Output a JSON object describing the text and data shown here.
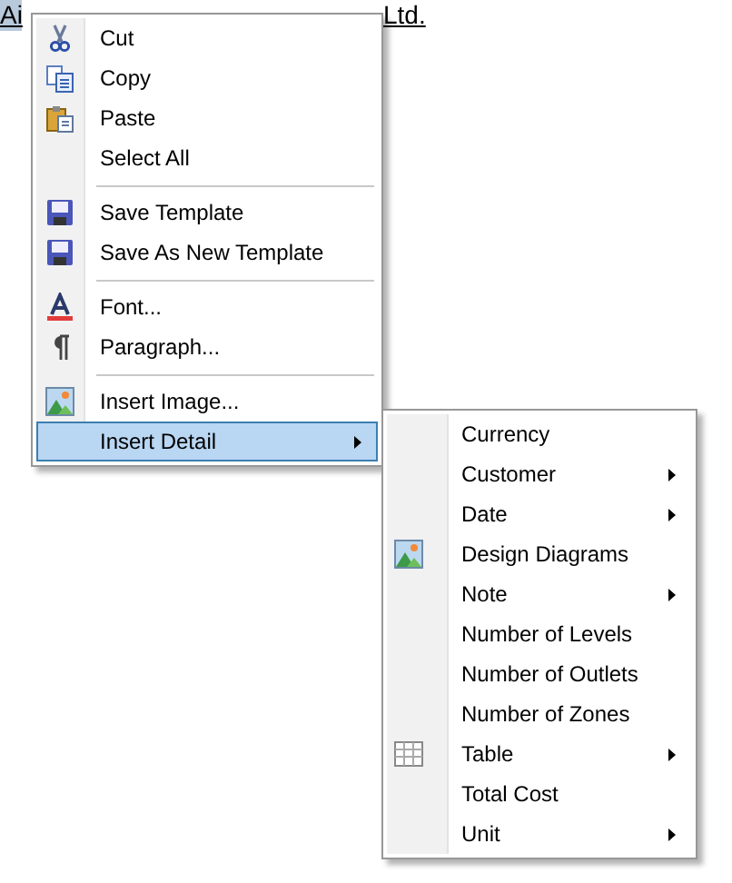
{
  "document": {
    "selected_text": "Ai",
    "visible_end": "Ltd."
  },
  "context_menu": [
    {
      "kind": "cut",
      "label": "Cut",
      "selected": false,
      "submenu": false
    },
    {
      "kind": "copy",
      "label": "Copy",
      "selected": false,
      "submenu": false
    },
    {
      "kind": "paste",
      "label": "Paste",
      "selected": false,
      "submenu": false
    },
    {
      "kind": "plain",
      "label": "Select All",
      "selected": false,
      "submenu": false
    },
    {
      "kind": "separator"
    },
    {
      "kind": "save",
      "label": "Save Template",
      "selected": false,
      "submenu": false
    },
    {
      "kind": "save",
      "label": "Save As New Template",
      "selected": false,
      "submenu": false
    },
    {
      "kind": "separator"
    },
    {
      "kind": "font",
      "label": "Font...",
      "selected": false,
      "submenu": false
    },
    {
      "kind": "paragraph",
      "label": "Paragraph...",
      "selected": false,
      "submenu": false
    },
    {
      "kind": "separator"
    },
    {
      "kind": "image",
      "label": "Insert Image...",
      "selected": false,
      "submenu": false
    },
    {
      "kind": "plain",
      "label": "Insert Detail",
      "selected": true,
      "submenu": true
    }
  ],
  "submenu": [
    {
      "kind": "plain",
      "label": "Currency",
      "selected": false,
      "submenu": false
    },
    {
      "kind": "plain",
      "label": "Customer",
      "selected": false,
      "submenu": true
    },
    {
      "kind": "plain",
      "label": "Date",
      "selected": false,
      "submenu": true
    },
    {
      "kind": "image",
      "label": "Design Diagrams",
      "selected": false,
      "submenu": false
    },
    {
      "kind": "plain",
      "label": "Note",
      "selected": false,
      "submenu": true
    },
    {
      "kind": "plain",
      "label": "Number of Levels",
      "selected": false,
      "submenu": false
    },
    {
      "kind": "plain",
      "label": "Number of Outlets",
      "selected": false,
      "submenu": false
    },
    {
      "kind": "plain",
      "label": "Number of Zones",
      "selected": false,
      "submenu": false
    },
    {
      "kind": "table",
      "label": "Table",
      "selected": false,
      "submenu": true
    },
    {
      "kind": "plain",
      "label": "Total Cost",
      "selected": false,
      "submenu": false
    },
    {
      "kind": "plain",
      "label": "Unit",
      "selected": false,
      "submenu": true
    }
  ]
}
